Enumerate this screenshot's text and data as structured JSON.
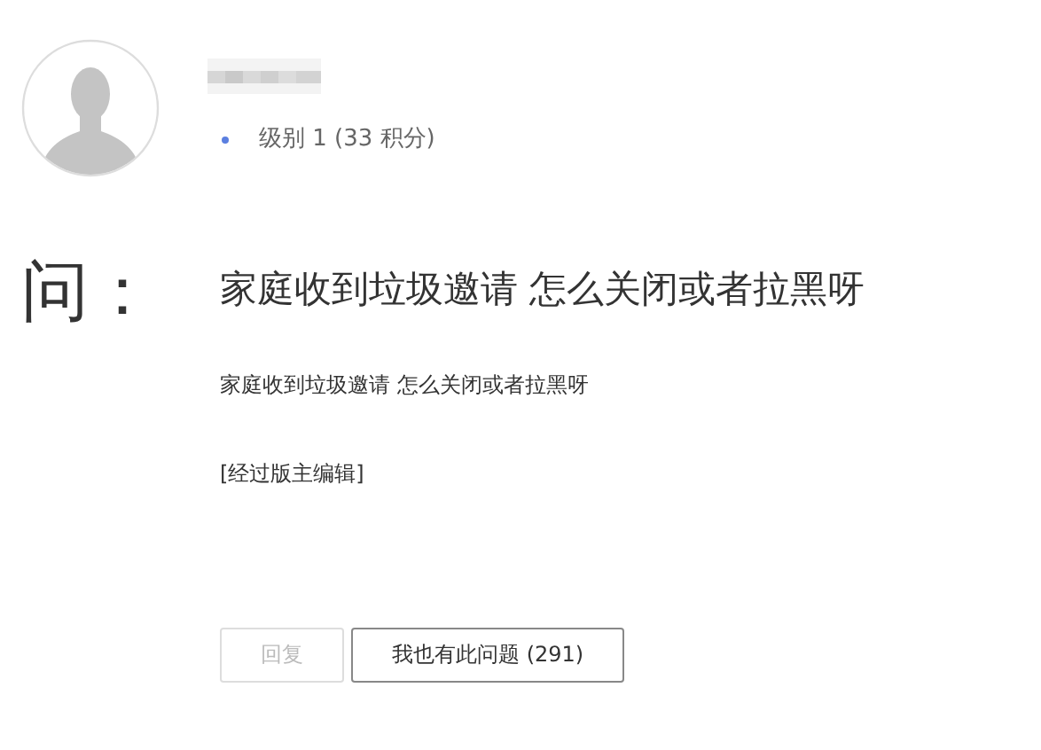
{
  "author": {
    "level": "级别 1 (33 积分)"
  },
  "question": {
    "label": "问：",
    "title": "家庭收到垃圾邀请 怎么关闭或者拉黑呀",
    "body": "家庭收到垃圾邀请 怎么关闭或者拉黑呀",
    "edit_note": "[经过版主编辑]"
  },
  "buttons": [
    {
      "label": "回复",
      "disabled": true
    },
    {
      "label": "我也有此问题 (291)",
      "disabled": false
    }
  ]
}
